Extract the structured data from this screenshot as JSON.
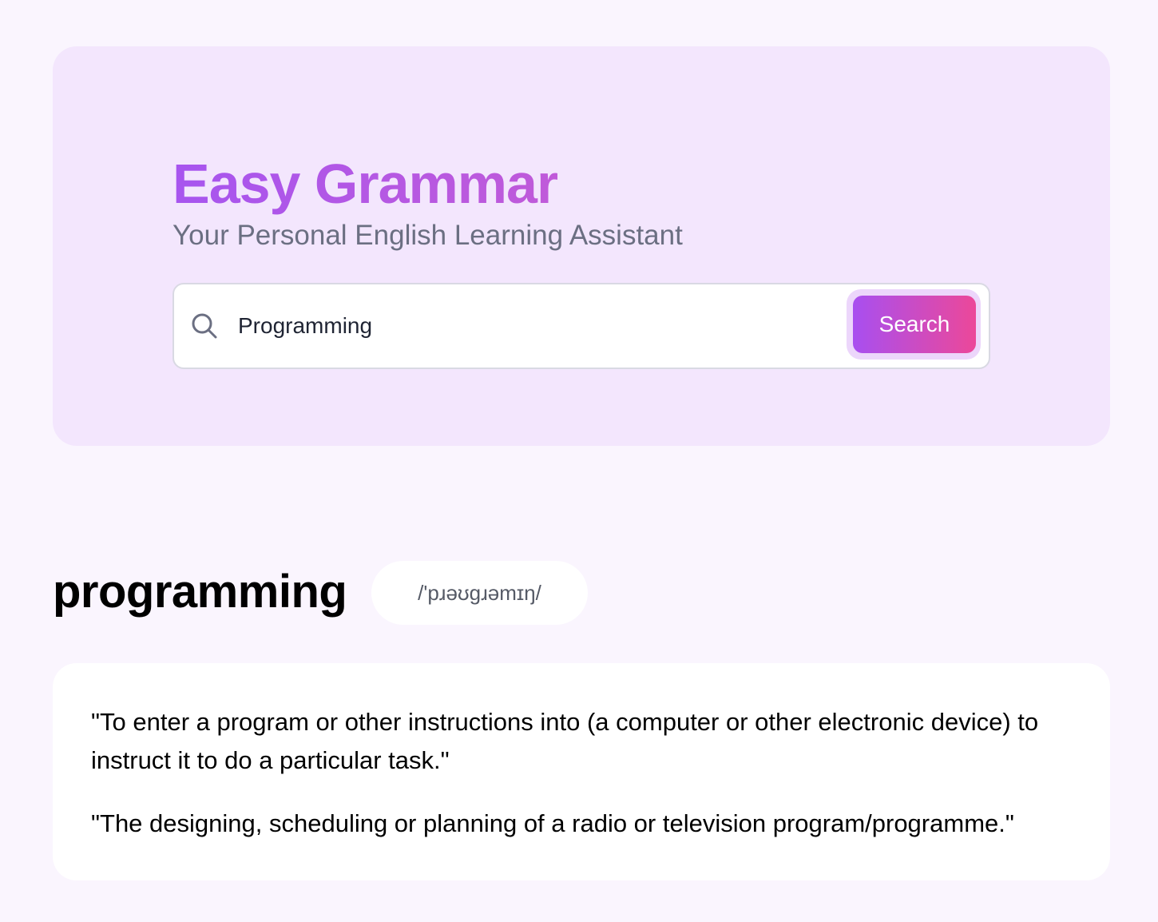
{
  "header": {
    "title": "Easy Grammar",
    "subtitle": "Your Personal English Learning Assistant"
  },
  "search": {
    "icon": "search-icon",
    "value": "Programming",
    "button_label": "Search"
  },
  "result": {
    "word": "programming",
    "phonetic": "/'pɹəʊɡɹəmɪŋ/",
    "definitions": [
      "\"To enter a program or other instructions into (a computer or other electronic device) to instruct it to do a particular task.\"",
      "\"The designing, scheduling or planning of a radio or television program/programme.\""
    ]
  },
  "colors": {
    "page_background": "#faf5fe",
    "hero_background": "#f3e6fd",
    "title_gradient_start": "#a755ef",
    "title_gradient_end": "#c05ad9",
    "button_gradient_start": "#a84ff0",
    "button_gradient_end": "#ec4899",
    "subtitle_text": "#6b6f82"
  }
}
